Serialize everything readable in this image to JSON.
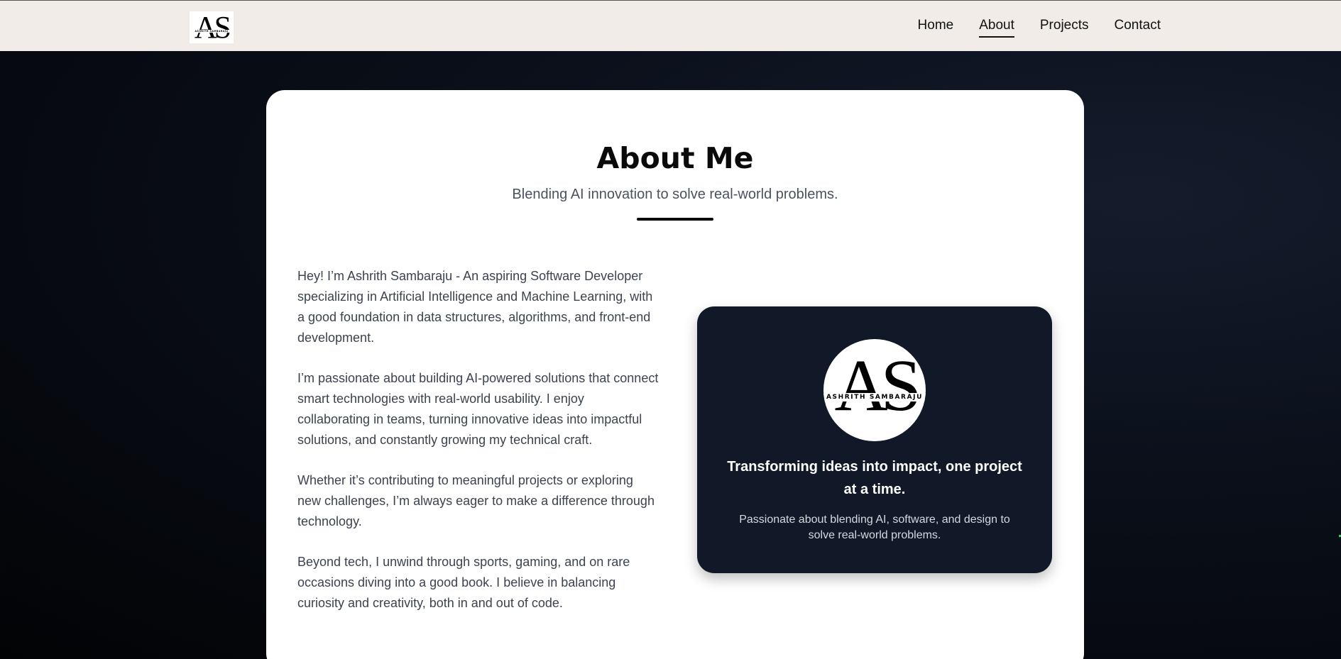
{
  "header": {
    "logo_letters": "AS",
    "logo_name": "ASHRITH SAMBARAJU",
    "nav": [
      {
        "label": "Home",
        "active": false
      },
      {
        "label": "About",
        "active": true
      },
      {
        "label": "Projects",
        "active": false
      },
      {
        "label": "Contact",
        "active": false
      }
    ]
  },
  "about": {
    "title": "About Me",
    "subtitle": "Blending AI innovation to solve real-world problems.",
    "paragraphs": [
      "Hey! I’m Ashrith Sambaraju - An aspiring Software Developer specializing in Artificial Intelligence and Machine Learning, with a good foundation in data structures, algorithms, and front-end development.",
      "I’m passionate about building AI-powered solutions that connect smart technologies with real-world usability. I enjoy collaborating in teams, turning innovative ideas into impactful solutions, and constantly growing my technical craft.",
      "Whether it’s contributing to meaningful projects or exploring new challenges, I’m always eager to make a difference through technology.",
      "Beyond tech, I unwind through sports, gaming, and on rare occasions diving into a good book. I believe in balancing curiosity and creativity, both in and out of code."
    ]
  },
  "profile_card": {
    "avatar_letters": "AS",
    "avatar_name": "ASHRITH SAMBARAJU",
    "tagline": "Transforming ideas into impact, one project at a time.",
    "description": "Passionate about blending AI, software, and design to solve real-world problems."
  },
  "colors": {
    "navbar_bg": "#f1ece8",
    "page_bg": "#0b101b",
    "card_bg": "#ffffff",
    "profile_card_bg": "#111827",
    "body_text": "#3b4350"
  }
}
